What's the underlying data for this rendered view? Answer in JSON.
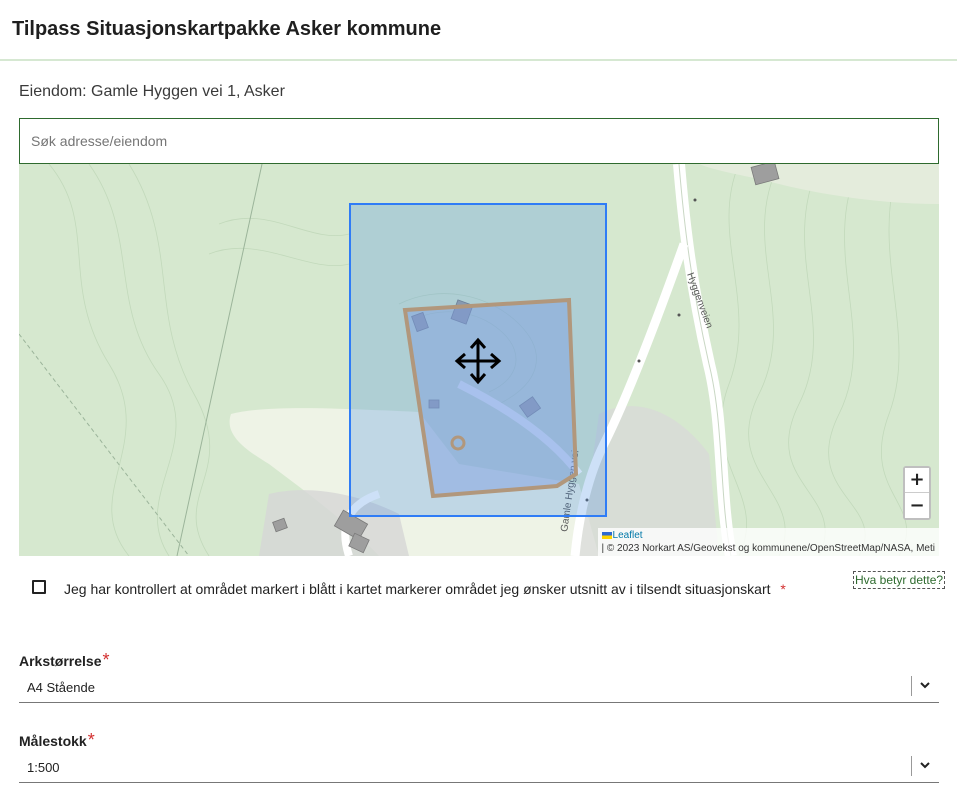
{
  "header": {
    "title": "Tilpass Situasjonskartpakke Asker kommune"
  },
  "property": {
    "text": "Eiendom: Gamle Hyggen vei 1, Asker"
  },
  "search": {
    "placeholder": "Søk adresse/eiendom",
    "value": ""
  },
  "map": {
    "road_labels": [
      "Hyggenveien",
      "Gamle Hyggen vei"
    ],
    "zoom_in": "+",
    "zoom_out": "−",
    "leaflet": "Leaflet",
    "attribution": "| © 2023 Norkart AS/Geovekst og kommunene/OpenStreetMap/NASA, Meti",
    "colors": {
      "forest": "#d6e8cf",
      "open_land": "#eef3e6",
      "road": "#ffffff",
      "selection": "#2f7cf6",
      "property_border": "#d99a55"
    }
  },
  "confirm": {
    "label": "Jeg har kontrollert at området markert i blått i kartet markerer området jeg ønsker utsnitt av i tilsendt situasjonskart",
    "required_mark": "*",
    "help_link": "Hva betyr dette?",
    "checked": false
  },
  "fields": {
    "sheet_size": {
      "label": "Arkstørrelse",
      "required_mark": "*",
      "value": "A4 Stående"
    },
    "scale": {
      "label": "Målestokk",
      "required_mark": "*",
      "value": "1:500"
    }
  }
}
